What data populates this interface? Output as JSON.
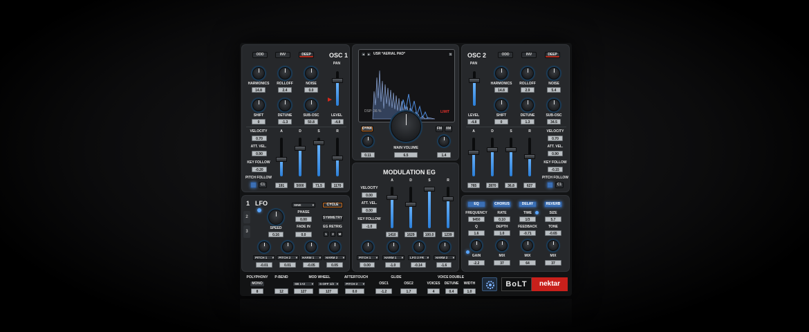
{
  "osc1": {
    "title": "OSC 1",
    "buttons": [
      "ODD",
      "INV",
      "DEEP"
    ],
    "pan": "PAN",
    "level": "LEVEL",
    "level_val": "-4.8",
    "knobs": [
      {
        "label": "HARMONICS",
        "value": "14.8"
      },
      {
        "label": "ROLLOFF",
        "value": "2.4"
      },
      {
        "label": "NOISE",
        "value": "0.0"
      },
      {
        "label": "SHIFT",
        "value": "0"
      },
      {
        "label": "DETUNE",
        "value": "-1.3"
      },
      {
        "label": "SUB-OSC",
        "value": "50.8"
      }
    ],
    "velocity": "VELOCITY",
    "velocity_val": "0.70",
    "att_vel": "ATT. VEL.",
    "att_vel_val": "0.90",
    "key_follow": "KEY FOLLOW",
    "key_follow_val": "-0.20",
    "pitch_follow": "PITCH FOLLOW",
    "c1": "C1",
    "adsr": [
      {
        "label": "A",
        "value": "191"
      },
      {
        "label": "D",
        "value": "5000"
      },
      {
        "label": "S",
        "value": "71.5"
      },
      {
        "label": "R",
        "value": "1170"
      }
    ]
  },
  "osc2": {
    "title": "OSC 2",
    "buttons": [
      "ODD",
      "INV",
      "DEEP"
    ],
    "pan": "PAN",
    "level": "LEVEL",
    "level_val": "-4.8",
    "knobs": [
      {
        "label": "HARMONICS",
        "value": "14.8"
      },
      {
        "label": "ROLLOFF",
        "value": "2.9"
      },
      {
        "label": "NOISE",
        "value": "5.4"
      },
      {
        "label": "SHIFT",
        "value": "0"
      },
      {
        "label": "DETUNE",
        "value": "1.3"
      },
      {
        "label": "SUB-OSC",
        "value": "34.5"
      }
    ],
    "velocity": "VELOCITY",
    "velocity_val": "0.70",
    "att_vel": "ATT. VEL.",
    "att_vel_val": "0.90",
    "key_follow": "KEY FOLLOW",
    "key_follow_val": "-0.15",
    "pitch_follow": "PITCH FOLLOW",
    "c1": "C1",
    "adsr": [
      {
        "label": "A",
        "value": "765"
      },
      {
        "label": "D",
        "value": "2870"
      },
      {
        "label": "S",
        "value": "36.8"
      },
      {
        "label": "R",
        "value": "627"
      }
    ]
  },
  "display": {
    "preset": "USR *AERIAL PAD*",
    "s_btn": "S",
    "dsp": "DSP: 36 %",
    "limit": "LIMIT",
    "dynx": "DYNX",
    "fm": "FM",
    "xm": "XM",
    "main_volume": "MAIN VOLUME",
    "main_volume_val": "6.5",
    "left_val": "0.11",
    "right_val": "1.4"
  },
  "mod_eg": {
    "title": "MODULATION EG",
    "velocity": "VELOCITY",
    "velocity_val": "0.00",
    "att_vel": "ATT. VEL.",
    "att_vel_val": "0.00",
    "key_follow": "KEY FOLLOW",
    "key_follow_val": "-1.0",
    "adsr": [
      {
        "label": "A",
        "value": "1410"
      },
      {
        "label": "D",
        "value": "1629"
      },
      {
        "label": "S",
        "value": "100.0"
      },
      {
        "label": "R",
        "value": "1239"
      }
    ],
    "dests": [
      {
        "name": "PITCH 1",
        "value": "0.00"
      },
      {
        "name": "HARM 1",
        "value": "-1.0"
      },
      {
        "name": "LFO 2 FR",
        "value": "-0.14"
      },
      {
        "name": "HARM 2",
        "value": "-1.6"
      }
    ]
  },
  "lfo": {
    "num": "1",
    "title": "LFO",
    "tabs": [
      "2",
      "3"
    ],
    "shape": "SINE",
    "cycle": "CYCLE",
    "phase": "PHASE",
    "phase_val": "0.00",
    "speed": "SPEED",
    "speed_val": "0.16",
    "fade_in": "FADE IN",
    "fade_in_val": "0.0",
    "symmetry": "SYMMETRY",
    "eg_retrig": "EG RETRIG",
    "retrig": [
      "1",
      "2",
      "M"
    ],
    "dests": [
      {
        "name": "PITCH 1",
        "value": "-0.01"
      },
      {
        "name": "PITCH 2",
        "value": "0.01"
      },
      {
        "name": "HARM 1",
        "value": "-0.05"
      },
      {
        "name": "HARM 2",
        "value": "0.05"
      }
    ]
  },
  "fx": {
    "buttons": [
      "EQ",
      "CHORUS",
      "DELAY",
      "REVERB"
    ],
    "row1": [
      {
        "label": "FREQUENCY",
        "value": "9450"
      },
      {
        "label": "RATE",
        "value": "0.10"
      },
      {
        "label": "TIME",
        "value": "1/3"
      },
      {
        "label": "SIZE",
        "value": "5.7"
      }
    ],
    "row2": [
      {
        "label": "Q",
        "value": "1.6"
      },
      {
        "label": "DEPTH",
        "value": "1.0"
      },
      {
        "label": "FEEDBACK",
        "value": "-0.71"
      },
      {
        "label": "TONE",
        "value": "-0.65"
      }
    ],
    "row3": [
      {
        "label": "GAIN",
        "value": "-2.2"
      },
      {
        "label": "MIX",
        "value": "37"
      },
      {
        "label": "MIX",
        "value": "64"
      },
      {
        "label": "MIX",
        "value": "37"
      }
    ]
  },
  "bottom": {
    "polyphony": "POLYPHONY",
    "mono": "MONO",
    "poly_val": "8",
    "pbend": "P-BEND",
    "pbend_val": "12",
    "mod_wheel": "MOD WHEEL",
    "mw1": "SB 1+2",
    "mw1_val": "127",
    "mw2": "S-OFF 1/2",
    "mw2_val": "127",
    "aftertouch": "AFTERTOUCH",
    "at": "PITCH 2",
    "at_val": "0.0",
    "glide": "GLIDE",
    "osc1": "OSC1",
    "osc1_val": "-1.2",
    "osc2": "OSC2",
    "osc2_val": "1.7",
    "voice_double": "VOICE DOUBLE",
    "voices": "VOICES",
    "voices_val": "4",
    "detune": "DETUNE",
    "detune_val": "0.4",
    "width": "WIDTH",
    "width_val": "1.0",
    "brand": "BoLT",
    "brand2": "nektar"
  },
  "colors": {
    "accent": "#59a5ff",
    "bg": "#26282b",
    "brand_red": "#c8201b"
  }
}
